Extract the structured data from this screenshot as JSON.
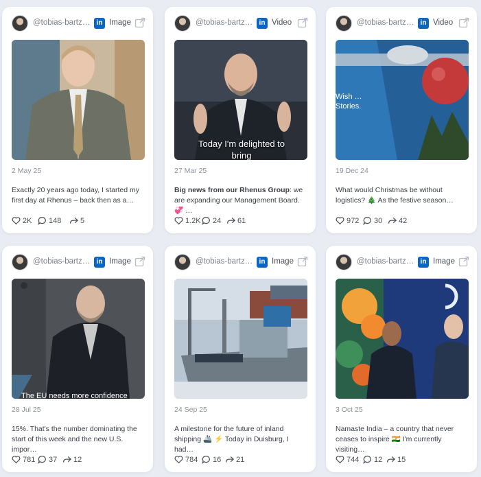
{
  "posts": [
    {
      "handle": "@tobias-bartz-…",
      "network_icon": "linkedin-icon",
      "type": "Image",
      "date": "2 May 25",
      "text_bold": "",
      "text": "Exactly 20 years ago today, I started my first day at Rhenus – back then as a…",
      "likes": "2K",
      "comments": "148",
      "shares": "5",
      "caption": ""
    },
    {
      "handle": "@tobias-bartz-…",
      "network_icon": "linkedin-icon",
      "type": "Video",
      "date": "27 Mar 25",
      "text_bold": "Big news from our Rhenus Group",
      "text": ": we are expanding our Management Board. 💞 …",
      "likes": "1.2K",
      "comments": "24",
      "shares": "61",
      "caption": "Today I'm delighted to bring"
    },
    {
      "handle": "@tobias-bartz-…",
      "network_icon": "linkedin-icon",
      "type": "Video",
      "date": "19 Dec 24",
      "text_bold": "",
      "text": "What would Christmas be without logistics? 🎄 As the festive season…",
      "likes": "972",
      "comments": "30",
      "shares": "42",
      "caption": "Wish … Stories."
    },
    {
      "handle": "@tobias-bartz-…",
      "network_icon": "linkedin-icon",
      "type": "Image",
      "date": "28 Jul 25",
      "text_bold": "",
      "text": "15%. That's the number dominating the start of this week and the new U.S. impor…",
      "likes": "781",
      "comments": "37",
      "shares": "12",
      "caption": "The EU needs more confidence"
    },
    {
      "handle": "@tobias-bartz-…",
      "network_icon": "linkedin-icon",
      "type": "Image",
      "date": "24 Sep 25",
      "text_bold": "",
      "text": "A milestone for the future of inland shipping 🚢 ⚡ Today in Duisburg, I had…",
      "likes": "784",
      "comments": "16",
      "shares": "21",
      "caption": ""
    },
    {
      "handle": "@tobias-bartz-…",
      "network_icon": "linkedin-icon",
      "type": "Image",
      "date": "3 Oct 25",
      "text_bold": "",
      "text": "Namaste India – a country that never ceases to inspire 🇮🇳 I'm currently visiting…",
      "likes": "744",
      "comments": "12",
      "shares": "15",
      "caption": ""
    }
  ],
  "colors": {
    "linkedin": "#0a66c2",
    "background": "#e9edf3",
    "card": "#ffffff"
  },
  "icons": {
    "like": "heart-icon",
    "comment": "comment-icon",
    "share": "share-icon",
    "open": "external-link-icon"
  }
}
